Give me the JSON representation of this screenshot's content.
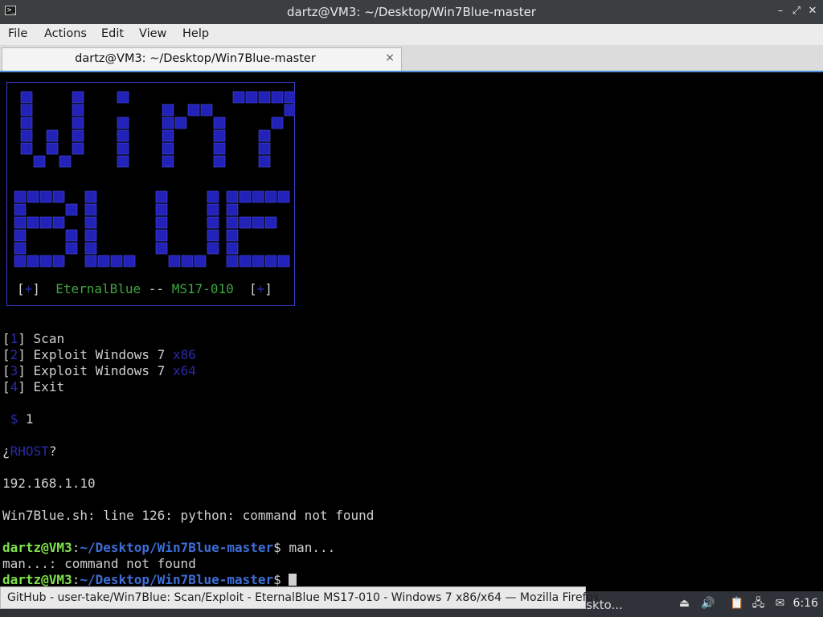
{
  "window": {
    "title": "dartz@VM3: ~/Desktop/Win7Blue-master",
    "app_icon_glyph": ">_",
    "controls": {
      "minimize": "–",
      "restore": "⤢",
      "close": "✕"
    }
  },
  "menu": [
    "File",
    "Actions",
    "Edit",
    "View",
    "Help"
  ],
  "tab": {
    "title": "dartz@VM3: ~/Desktop/Win7Blue-master",
    "close_glyph": "×"
  },
  "banner": {
    "art_text": "Win7 Blue",
    "caption": {
      "bracket_open": "[",
      "plus": "+",
      "bracket_close": "]",
      "name": "EternalBlue",
      "sep": " -- ",
      "code": "MS17-010"
    }
  },
  "menu_options": [
    {
      "num": "1",
      "label": "Scan",
      "arch": ""
    },
    {
      "num": "2",
      "label": "Exploit Windows 7",
      "arch": "x86"
    },
    {
      "num": "3",
      "label": "Exploit Windows 7",
      "arch": "x64"
    },
    {
      "num": "4",
      "label": "Exit",
      "arch": ""
    }
  ],
  "prompt_symbol": "$",
  "choice": "1",
  "rhost": {
    "open": "¿",
    "word": "RHOST",
    "close": "?"
  },
  "ip": "192.168.1.10",
  "error_line": "Win7Blue.sh: line 126: python: command not found",
  "shell": {
    "user_host": "dartz@VM3",
    "colon": ":",
    "path": "~/Desktop/Win7Blue-master",
    "dollar": "$",
    "cmd1": "man...",
    "out1": "man...: command not found"
  },
  "tooltip": "GitHub - user-take/Win7Blue: Scan/Exploit - EternalBlue MS17-010 - Windows 7 x86/x64 — Mozilla Firefox",
  "panel": {
    "task_label": "eskto...",
    "tray_icons": [
      "eject-icon",
      "volume-icon",
      "clipboard-icon",
      "network-icon",
      "notification-icon"
    ],
    "clock": "6:16"
  },
  "colors": {
    "titlebar": "#3c3f41",
    "accent": "#4a90d9",
    "banner_blue": "#2222b8",
    "prompt_green": "#7ee24a",
    "prompt_path": "#3d6ed8"
  }
}
